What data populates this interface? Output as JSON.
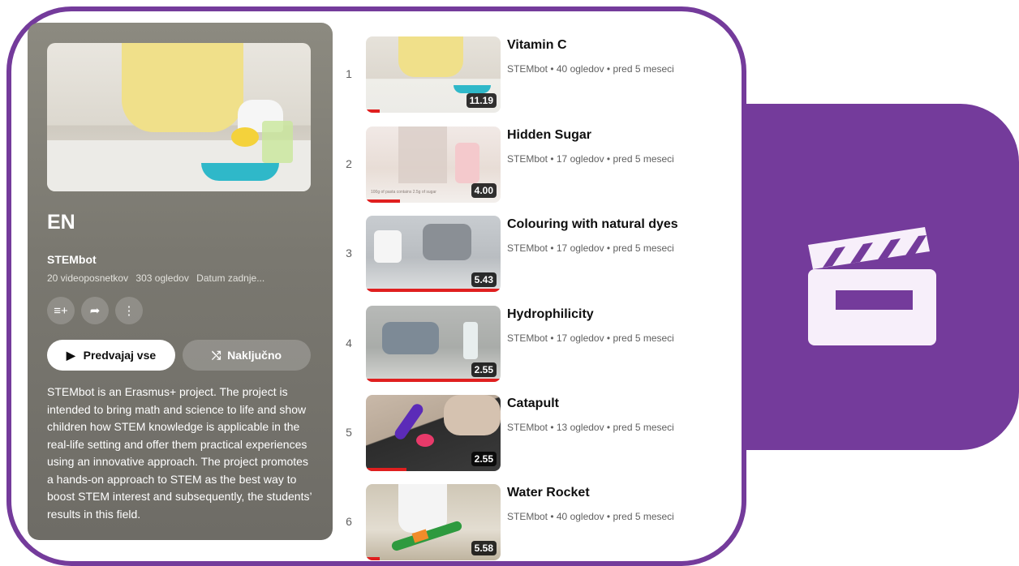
{
  "playlist": {
    "title": "EN",
    "channel": "STEMbot",
    "video_count": "20 videoposnetkov",
    "views": "303 ogledov",
    "updated": "Datum zadnje...",
    "play_all_label": "Predvajaj vse",
    "shuffle_label": "Naključno",
    "description": "STEMbot is an Erasmus+ project. The project is intended to bring math and science to life and show children how STEM knowledge is applicable in the real-life setting and offer them practical experiences using an innovative approach. The project promotes a hands-on approach to STEM as the best way to boost STEM interest and subsequently, the students’ results in this field.",
    "icons": [
      "add-to-queue-icon",
      "share-icon",
      "more-icon"
    ]
  },
  "videos": [
    {
      "index": "1",
      "title": "Vitamin C",
      "meta": "STEMbot • 40 ogledov • pred 5 meseci",
      "duration": "11.19",
      "progress": 0.1
    },
    {
      "index": "2",
      "title": "Hidden Sugar",
      "meta": "STEMbot • 17 ogledov • pred 5 meseci",
      "duration": "4.00",
      "progress": 0.25,
      "thumb_caption": "100g of pasta contains 2.5g of sugar"
    },
    {
      "index": "3",
      "title": "Colouring with natural dyes",
      "meta": "STEMbot • 17 ogledov • pred 5 meseci",
      "duration": "5.43",
      "progress": 1.0
    },
    {
      "index": "4",
      "title": "Hydrophilicity",
      "meta": "STEMbot • 17 ogledov • pred 5 meseci",
      "duration": "2.55",
      "progress": 1.0
    },
    {
      "index": "5",
      "title": "Catapult",
      "meta": "STEMbot • 13 ogledov • pred 5 meseci",
      "duration": "2.55",
      "progress": 0.3
    },
    {
      "index": "6",
      "title": "Water Rocket",
      "meta": "STEMbot • 40 ogledov • pred 5 meseci",
      "duration": "5.58",
      "progress": 0.1
    }
  ],
  "colors": {
    "accent_purple": "#743b9b",
    "progress_red": "#e01f1f"
  }
}
